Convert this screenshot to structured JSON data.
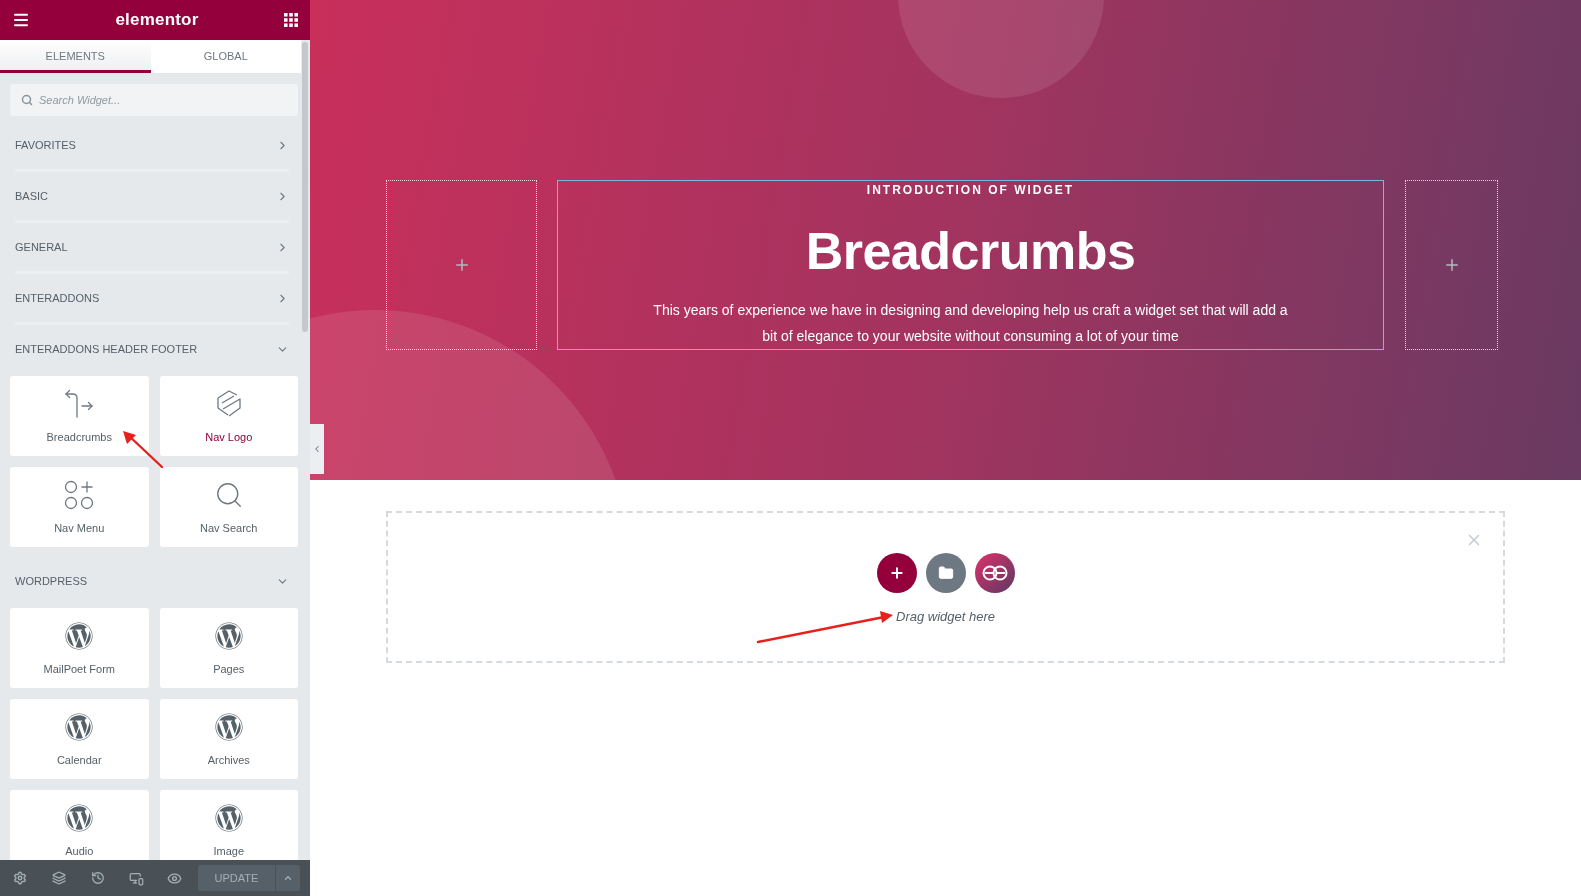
{
  "sidebar": {
    "logo": "elementor",
    "tabs": [
      {
        "label": "ELEMENTS",
        "selected": true
      },
      {
        "label": "GLOBAL",
        "selected": false
      }
    ],
    "search": {
      "placeholder": "Search Widget..."
    },
    "categories": [
      {
        "title": "FAVORITES",
        "expanded": false
      },
      {
        "title": "BASIC",
        "expanded": false
      },
      {
        "title": "GENERAL",
        "expanded": false
      },
      {
        "title": "ENTERADDONS",
        "expanded": false
      },
      {
        "title": "ENTERADDONS HEADER FOOTER",
        "expanded": true,
        "widgets": [
          {
            "label": "Breadcrumbs",
            "kind": "breadcrumbs",
            "highlighted": false
          },
          {
            "label": "Nav Logo",
            "kind": "logo",
            "highlighted": true
          },
          {
            "label": "Nav Menu",
            "kind": "menu",
            "highlighted": false
          },
          {
            "label": "Nav Search",
            "kind": "search",
            "highlighted": false
          }
        ]
      },
      {
        "title": "WORDPRESS",
        "expanded": true,
        "widgets": [
          {
            "label": "MailPoet Form",
            "kind": "wordpress",
            "highlighted": false
          },
          {
            "label": "Pages",
            "kind": "wordpress",
            "highlighted": false
          },
          {
            "label": "Calendar",
            "kind": "wordpress",
            "highlighted": false
          },
          {
            "label": "Archives",
            "kind": "wordpress",
            "highlighted": false
          },
          {
            "label": "Audio",
            "kind": "wordpress",
            "highlighted": false
          },
          {
            "label": "Image",
            "kind": "wordpress",
            "highlighted": false
          }
        ]
      }
    ],
    "toolbar": {
      "update_button": {
        "label": "UPDATE",
        "disabled": true
      }
    }
  },
  "canvas": {
    "hero": {
      "eyebrow": "INTRODUCTION OF WIDGET",
      "heading": "Breadcrumbs",
      "text": "This years of experience we have in designing and developing help us craft a widget set that will add a bit of elegance to your website without consuming a lot of your time"
    },
    "drop_zone": {
      "hint": "Drag widget here"
    }
  }
}
